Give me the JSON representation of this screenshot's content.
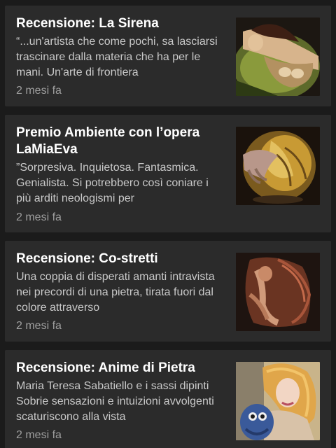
{
  "articles": [
    {
      "title": "Recensione: La Sirena",
      "excerpt": "“...un'artista che come pochi, sa lasciarsi trascinare dalla materia che ha per le mani. Un'arte di frontiera",
      "time": "2 mesi fa",
      "thumbnail_icon": "sculpture-siren-image"
    },
    {
      "title": "Premio Ambiente con l’opera LaMiaEva",
      "excerpt": "”Sorpresiva. Inquietosa. Fantasmica. Genialista. Si potrebbero così coniare i più arditi neologismi per",
      "time": "2 mesi fa",
      "thumbnail_icon": "sculpture-lamiaeva-image"
    },
    {
      "title": "Recensione: Co-stretti",
      "excerpt": "Una coppia di disperati amanti intravista nei precordi di una pietra, tirata fuori dal colore attraverso",
      "time": "2 mesi fa",
      "thumbnail_icon": "sculpture-costretti-image"
    },
    {
      "title": "Recensione: Anime di Pietra",
      "excerpt": "Maria Teresa Sabatiello e i sassi dipinti Sobrie sensazioni e intuizioni avvolgenti scaturiscono alla vista",
      "time": "2 mesi fa",
      "thumbnail_icon": "artist-portrait-image"
    }
  ]
}
